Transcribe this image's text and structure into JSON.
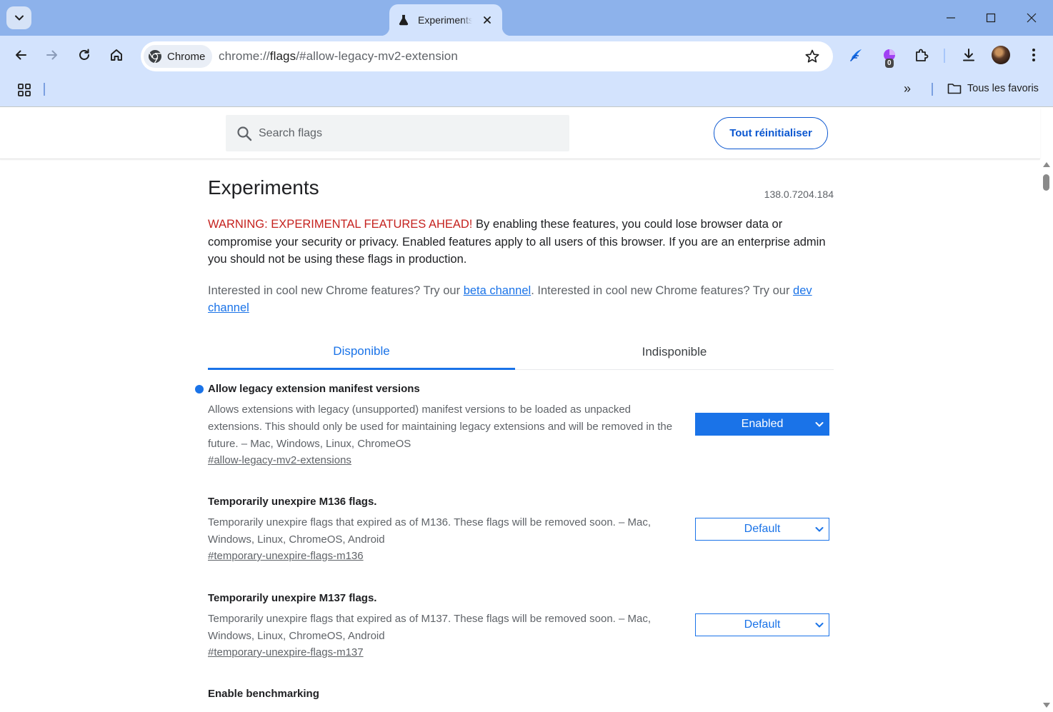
{
  "browser": {
    "tab": {
      "title": "Experiments",
      "favicon": "flask-icon"
    },
    "window_controls": [
      "minimize",
      "maximize",
      "close"
    ],
    "chip_label": "Chrome",
    "url": {
      "scheme": "chrome://",
      "host": "flags",
      "path": "/#allow-legacy-mv2-extension"
    },
    "extension_badge": "0",
    "bookmarks": {
      "overflow": "»",
      "folder_label": "Tous les favoris"
    },
    "colors": {
      "tabstrip": "#8db2eb",
      "toolbar": "#d3e3fd",
      "accent": "#1a73e8"
    }
  },
  "header": {
    "search_placeholder": "Search flags",
    "reset_label": "Tout réinitialiser"
  },
  "main": {
    "title": "Experiments",
    "version": "138.0.7204.184",
    "warning_prefix": "WARNING: EXPERIMENTAL FEATURES AHEAD!",
    "warning_text": " By enabling these features, you could lose browser data or compromise your security or privacy. Enabled features apply to all users of this browser. If you are an enterprise admin you should not be using these flags in production.",
    "promo_text_1": "Interested in cool new Chrome features? Try our ",
    "promo_link_1": "beta channel",
    "promo_text_2": ". Interested in cool new Chrome features? Try our ",
    "promo_link_2": "dev channel",
    "tabs": [
      {
        "label": "Disponible",
        "active": true
      },
      {
        "label": "Indisponible",
        "active": false
      }
    ]
  },
  "experiments": [
    {
      "title": "Allow legacy extension manifest versions",
      "description": "Allows extensions with legacy (unsupported) manifest versions to be loaded as unpacked extensions. This should only be used for maintaining legacy extensions and will be removed in the future. – Mac, Windows, Linux, ChromeOS",
      "link": "#allow-legacy-mv2-extensions",
      "value": "Enabled",
      "modified": true
    },
    {
      "title": "Temporarily unexpire M136 flags.",
      "description": "Temporarily unexpire flags that expired as of M136. These flags will be removed soon. – Mac, Windows, Linux, ChromeOS, Android",
      "link": "#temporary-unexpire-flags-m136",
      "value": "Default",
      "modified": false
    },
    {
      "title": "Temporarily unexpire M137 flags.",
      "description": "Temporarily unexpire flags that expired as of M137. These flags will be removed soon. – Mac, Windows, Linux, ChromeOS, Android",
      "link": "#temporary-unexpire-flags-m137",
      "value": "Default",
      "modified": false
    },
    {
      "title": "Enable benchmarking",
      "description": "",
      "link": "",
      "value": "",
      "modified": false
    }
  ]
}
